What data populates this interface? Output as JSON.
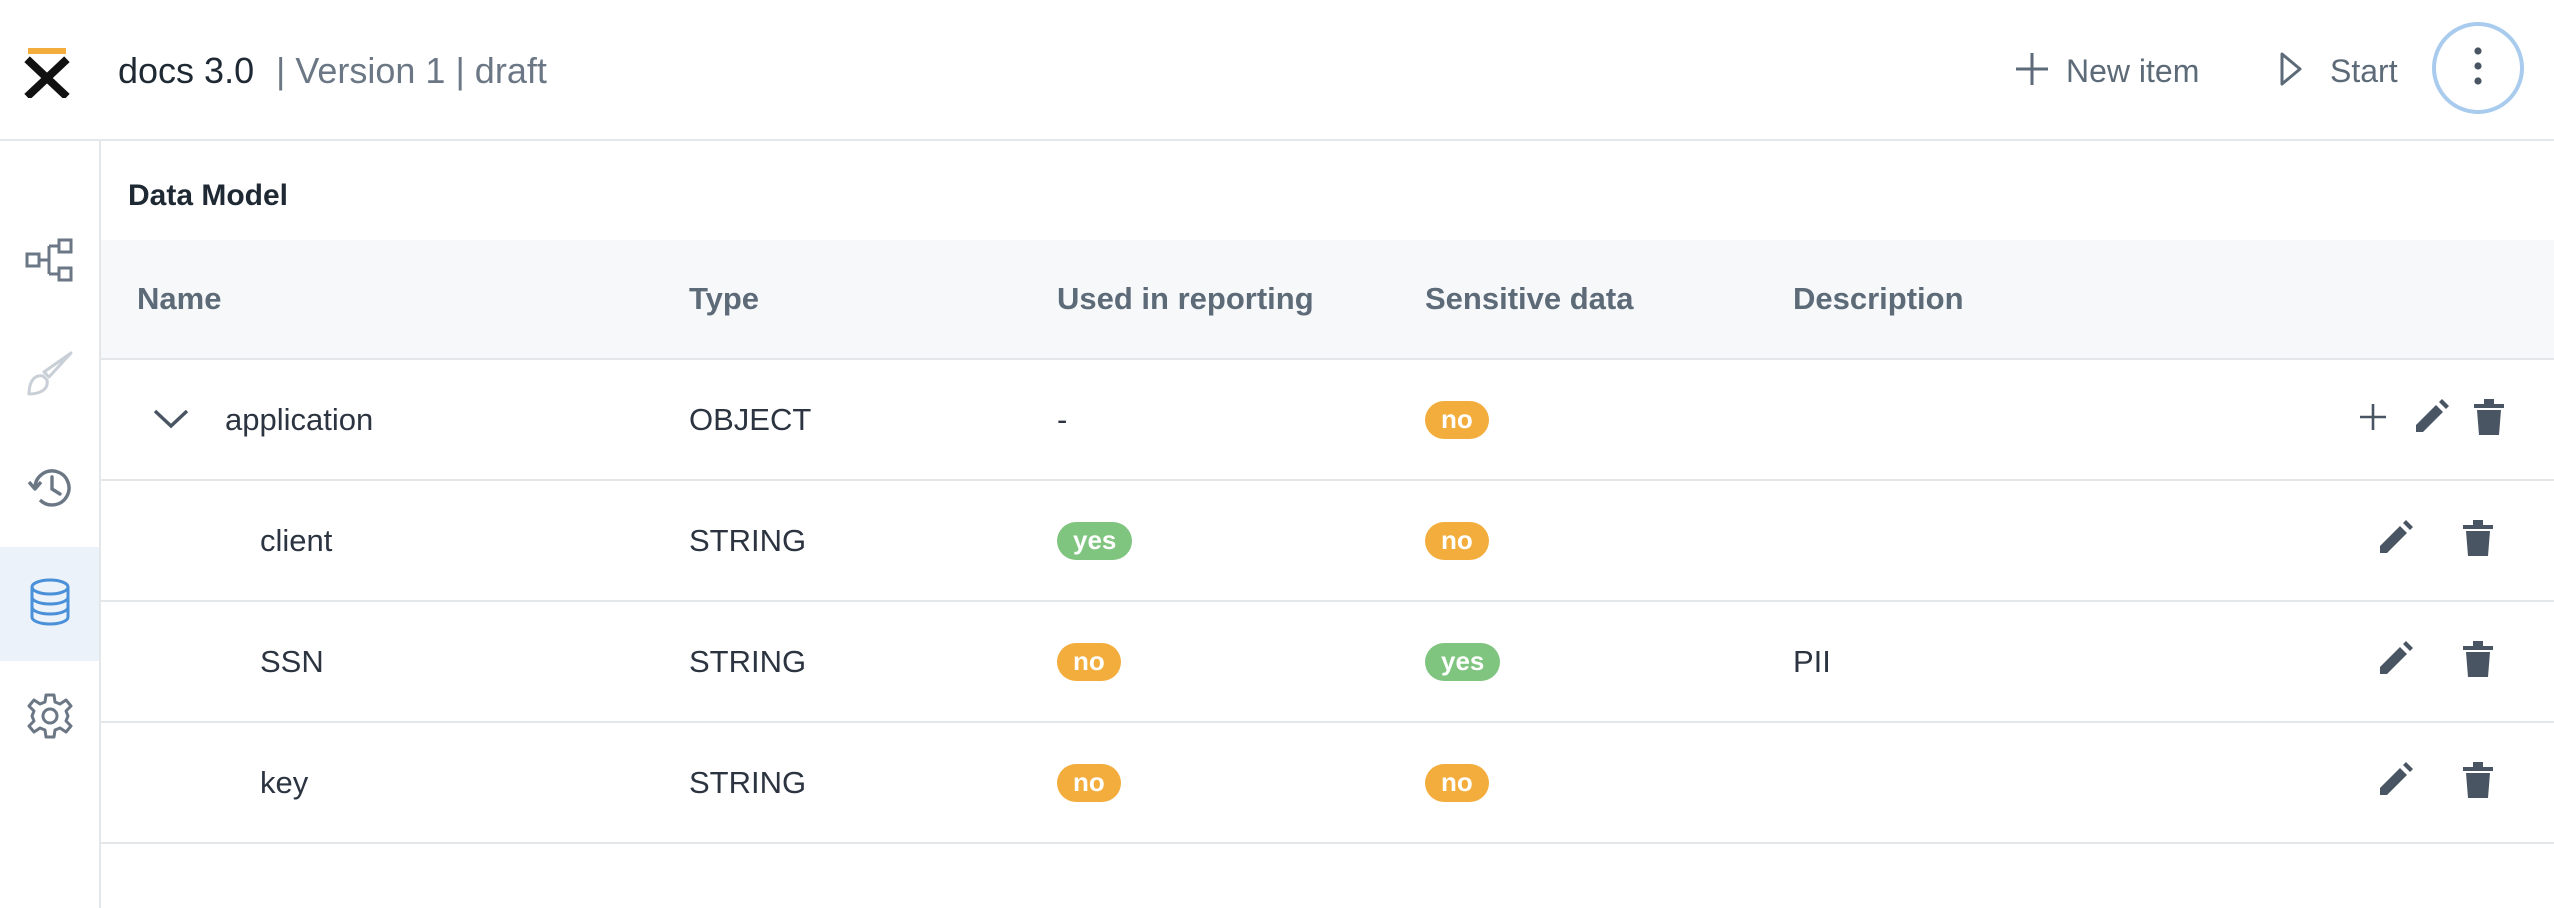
{
  "header": {
    "app_title": "docs 3.0",
    "meta": "| Version 1 | draft",
    "new_item_label": "New item",
    "start_label": "Start"
  },
  "sidebar": {
    "items": [
      {
        "icon": "process-tree-icon",
        "active": false
      },
      {
        "icon": "brush-icon",
        "active": false
      },
      {
        "icon": "history-icon",
        "active": false
      },
      {
        "icon": "database-icon",
        "active": true
      },
      {
        "icon": "gear-icon",
        "active": false
      }
    ]
  },
  "main": {
    "title": "Data Model",
    "columns": [
      "Name",
      "Type",
      "Used in reporting",
      "Sensitive data",
      "Description"
    ],
    "rows": [
      {
        "name": "application",
        "type": "OBJECT",
        "reporting": "-",
        "sensitive": "no",
        "description": "",
        "expandable": true
      },
      {
        "name": "client",
        "type": "STRING",
        "reporting": "yes",
        "sensitive": "no",
        "description": ""
      },
      {
        "name": "SSN",
        "type": "STRING",
        "reporting": "no",
        "sensitive": "yes",
        "description": "PII"
      },
      {
        "name": "key",
        "type": "STRING",
        "reporting": "no",
        "sensitive": "no",
        "description": ""
      }
    ]
  },
  "colors": {
    "badge_no": "#f2ad3c",
    "badge_yes": "#7fc47f",
    "accent": "#4a90d9",
    "logo_yellow": "#f2ad3c"
  }
}
